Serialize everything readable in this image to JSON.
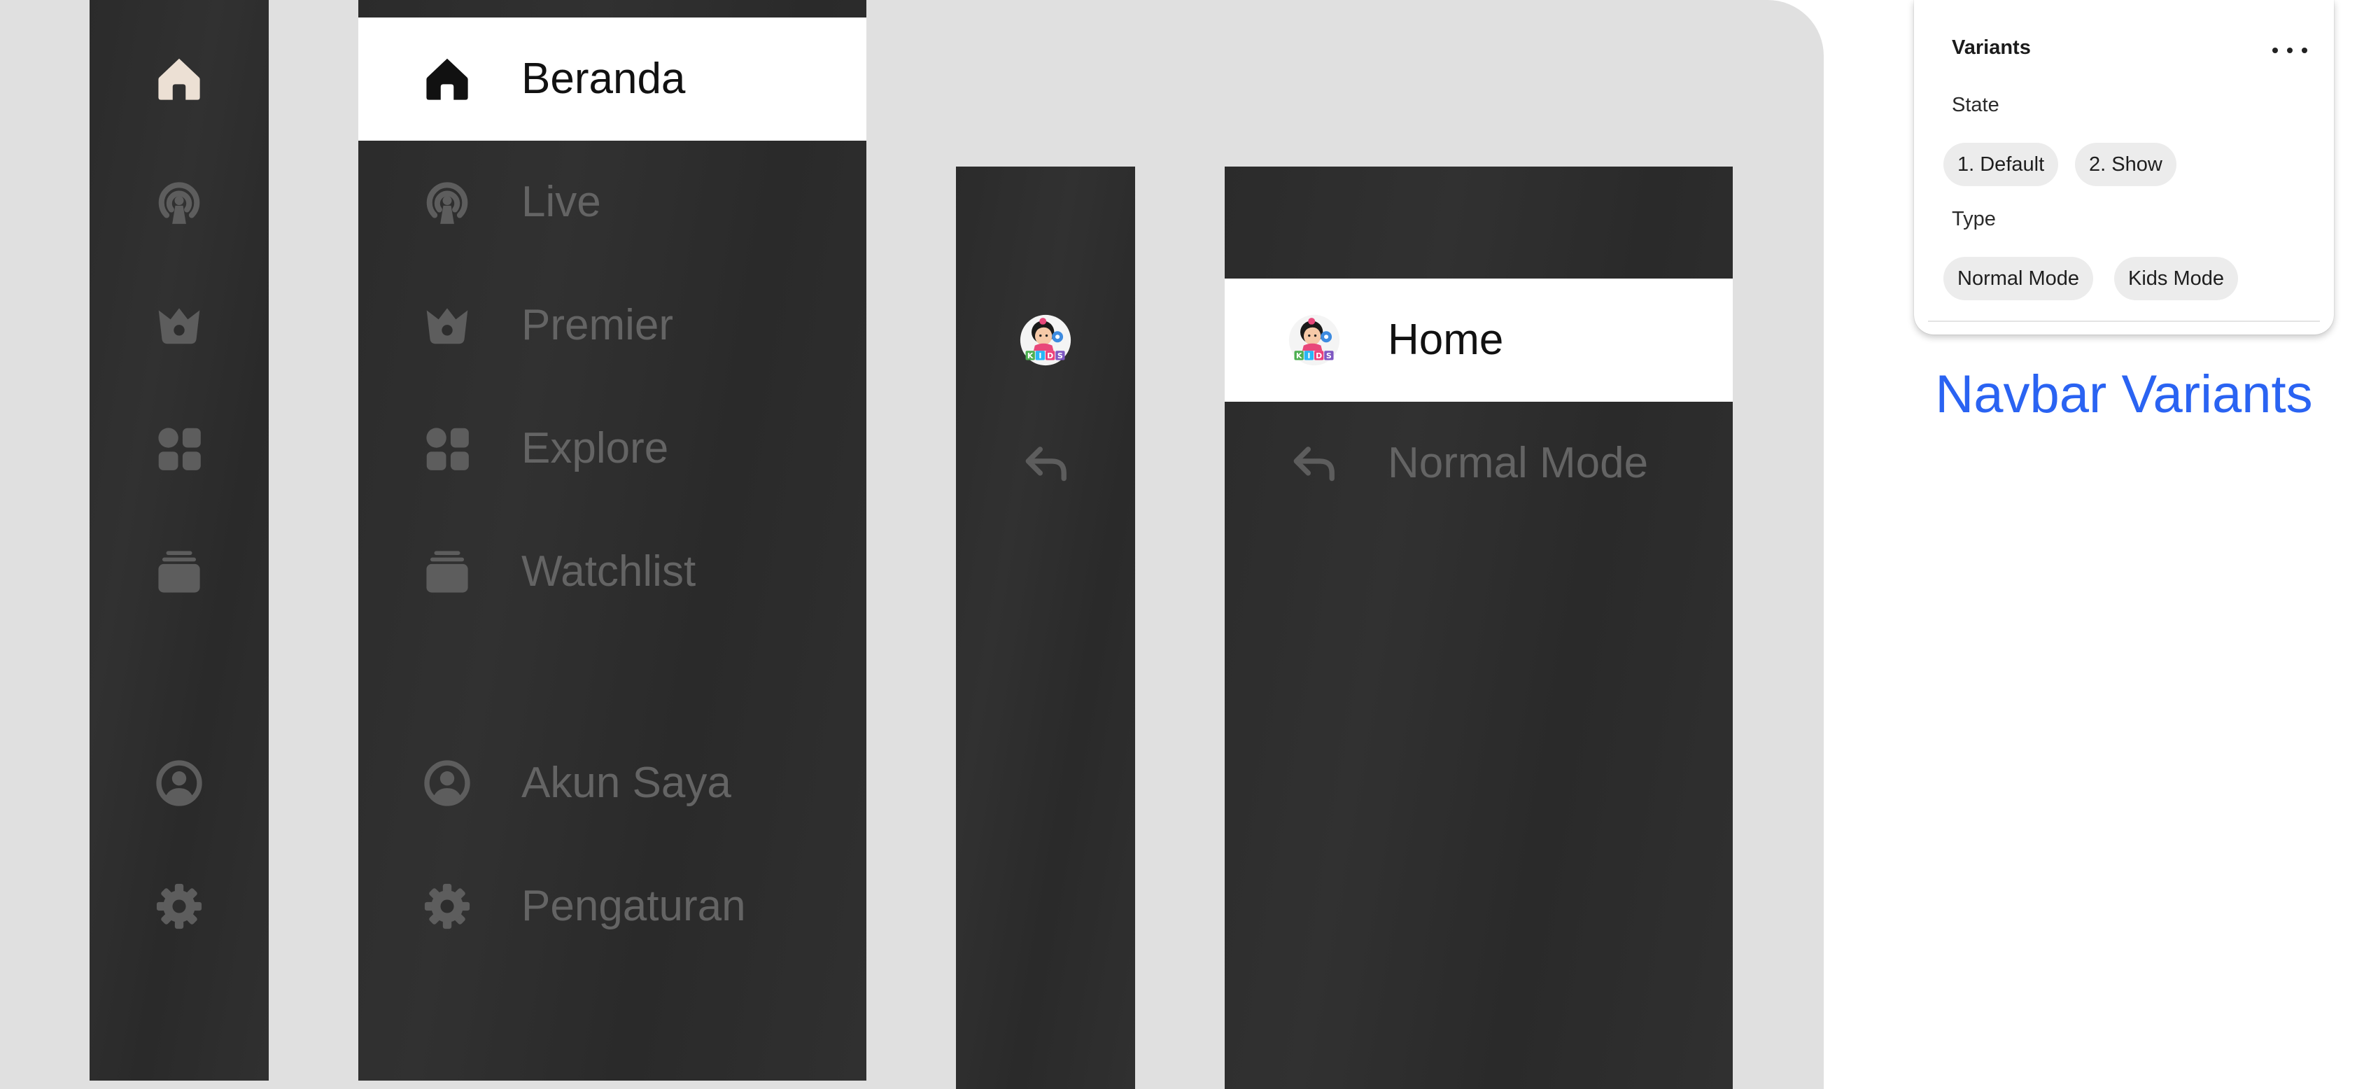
{
  "nav_normal": {
    "items": [
      {
        "icon": "home-icon",
        "label": "Beranda",
        "active": true
      },
      {
        "icon": "live-broadcast-icon",
        "label": "Live"
      },
      {
        "icon": "crown-icon",
        "label": "Premier"
      },
      {
        "icon": "grid-icon",
        "label": "Explore"
      },
      {
        "icon": "stack-icon",
        "label": "Watchlist"
      }
    ],
    "bottom_items": [
      {
        "icon": "account-icon",
        "label": "Akun Saya"
      },
      {
        "icon": "gear-icon",
        "label": "Pengaturan"
      }
    ]
  },
  "nav_kids": {
    "items": [
      {
        "icon": "kids-logo-icon",
        "label": "Home",
        "active": true
      },
      {
        "icon": "back-arrow-icon",
        "label": "Normal Mode"
      }
    ]
  },
  "variants_panel": {
    "title": "Variants",
    "state_label": "State",
    "state_options": [
      "1. Default",
      "2. Show"
    ],
    "type_label": "Type",
    "type_options": [
      "Normal Mode",
      "Kids Mode"
    ],
    "caption": "Navbar Variants"
  },
  "colors": {
    "nav_bg": "#2d2d2d",
    "active_bg": "#ffffff",
    "inactive_text": "#646464",
    "active_icon_collapsed": "#ece0d4",
    "caption_accent": "#2a63f2"
  }
}
